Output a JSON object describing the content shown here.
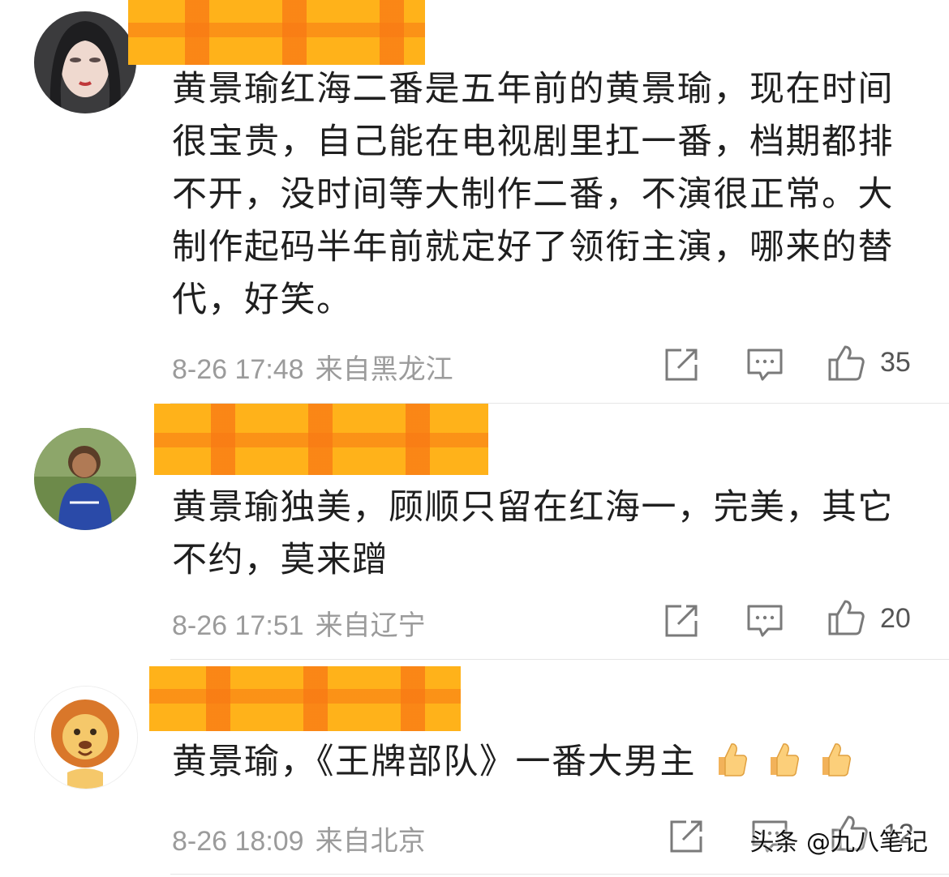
{
  "comments": [
    {
      "text": "黄景瑜红海二番是五年前的黄景瑜，现在时间很宝贵，自己能在电视剧里扛一番，档期都排不开，没时间等大制作二番，不演很正常。大制作起码半年前就定好了领衔主演，哪来的替代，好笑。",
      "time": "8-26 17:48",
      "location": "来自黑龙江",
      "likes": "35"
    },
    {
      "text": "黄景瑜独美，顾顺只留在红海一，完美，其它不约，莫来蹭",
      "time": "8-26 17:51",
      "location": "来自辽宁",
      "likes": "20"
    },
    {
      "text": "黄景瑜，《王牌部队》一番大男主",
      "time": "8-26 18:09",
      "location": "来自北京",
      "likes": "12"
    }
  ],
  "icons": {
    "share": "share-icon",
    "reply": "comment-icon",
    "like": "thumbs-up-icon",
    "emoji": "thumbs-up-emoji"
  },
  "watermark": "头条 @九八笔记",
  "colors": {
    "redaction": "#ffb21a",
    "meta_text": "#9b9b9b"
  }
}
